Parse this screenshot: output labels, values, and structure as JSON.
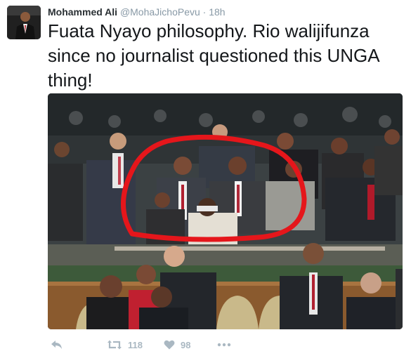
{
  "user": {
    "name": "Mohammed Ali",
    "handle": "@MohaJichoPevu",
    "separator": "·",
    "time": "18h"
  },
  "tweet": {
    "text": "Fuata Nyayo philosophy. Rio walijifunza since no journalist questioned this UNGA thing!"
  },
  "actions": {
    "retweet_count": "118",
    "like_count": "98"
  },
  "icons": {
    "reply": "reply-icon",
    "retweet": "retweet-icon",
    "like": "heart-icon",
    "more": "more-icon"
  },
  "colors": {
    "text": "#14171a",
    "muted": "#8899a6",
    "action": "#aab8c2",
    "annotation": "#e5161b"
  }
}
